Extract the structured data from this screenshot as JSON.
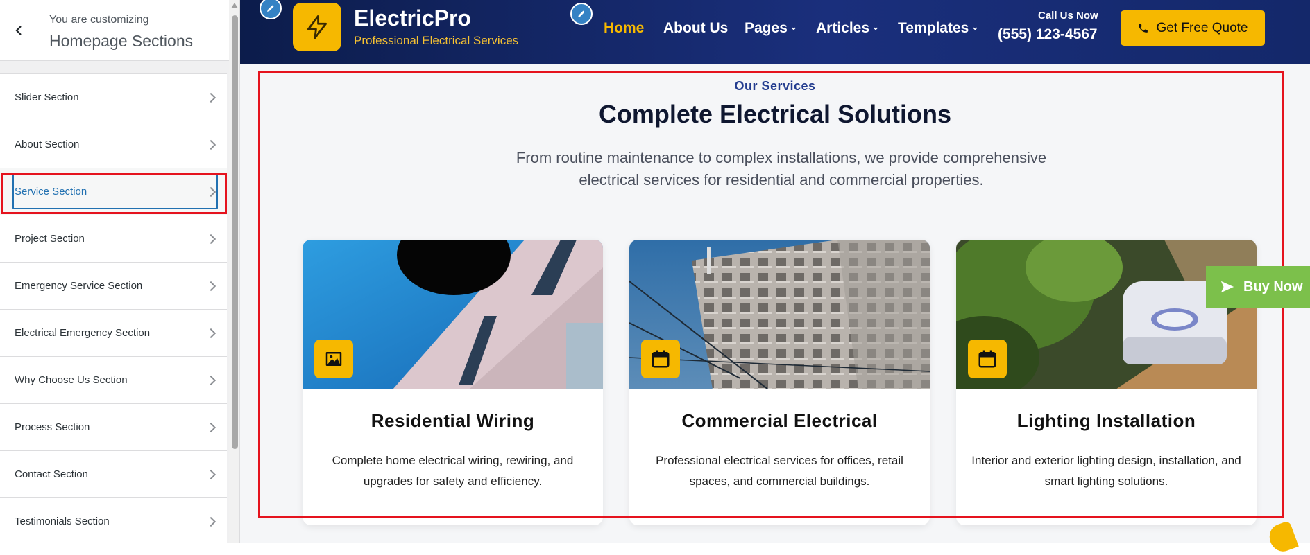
{
  "customizer": {
    "subtitle": "You are customizing",
    "title": "Homepage Sections",
    "sections": [
      {
        "label": "Slider Section"
      },
      {
        "label": "About Section"
      },
      {
        "label": "Service Section"
      },
      {
        "label": "Project Section"
      },
      {
        "label": "Emergency Service Section"
      },
      {
        "label": "Electrical Emergency Section"
      },
      {
        "label": "Why Choose Us Section"
      },
      {
        "label": "Process Section"
      },
      {
        "label": "Contact Section"
      },
      {
        "label": "Testimonials Section"
      }
    ],
    "active_section": "Service Section"
  },
  "site": {
    "brand": "ElectricPro",
    "tagline": "Professional Electrical Services",
    "nav": [
      {
        "label": "Home",
        "active": true
      },
      {
        "label": "About Us"
      },
      {
        "label": "Pages",
        "dropdown": true
      },
      {
        "label": "Articles",
        "dropdown": true
      },
      {
        "label": "Templates",
        "dropdown": true
      }
    ],
    "call_label": "Call Us Now",
    "phone": "(555) 123-4567",
    "quote_button": "Get Free Quote"
  },
  "services": {
    "eyebrow": "Our Services",
    "title": "Complete Electrical Solutions",
    "description": "From routine maintenance to complex installations, we provide comprehensive electrical services for residential and commercial properties.",
    "cards": [
      {
        "title": "Residential Wiring",
        "text": "Complete home electrical wiring, rewiring, and upgrades for safety and efficiency.",
        "icon": "image-icon"
      },
      {
        "title": "Commercial Electrical",
        "text": "Professional electrical services for offices, retail spaces, and commercial buildings.",
        "icon": "calendar-icon"
      },
      {
        "title": "Lighting Installation",
        "text": "Interior and exterior lighting design, installation, and smart lighting solutions.",
        "icon": "calendar-icon"
      }
    ]
  },
  "buy_now": "Buy Now",
  "colors": {
    "accent": "#f6b800",
    "header": "#14286a",
    "highlight": "#e5131e",
    "wp_blue": "#2271b1"
  }
}
